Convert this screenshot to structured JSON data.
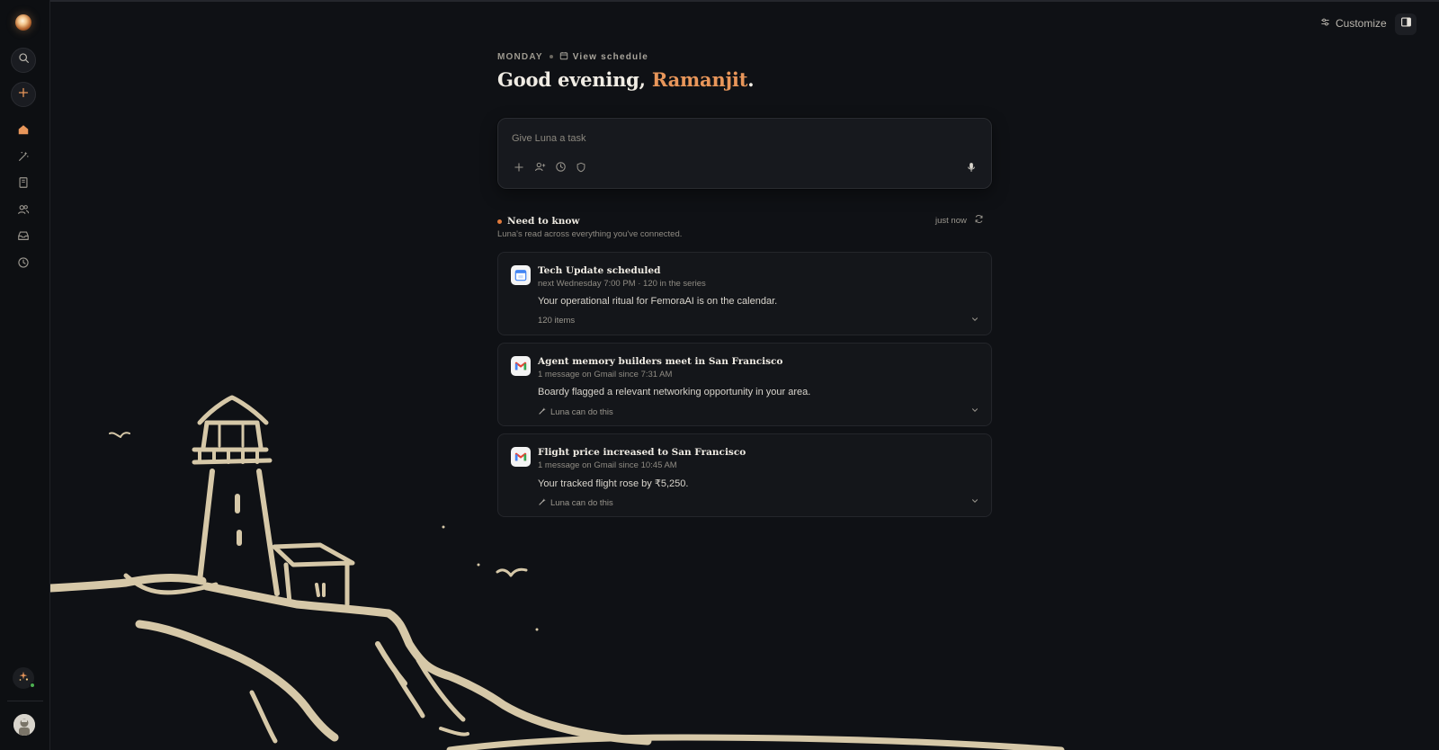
{
  "header": {
    "day": "MONDAY",
    "view_schedule": "View schedule",
    "greeting_prefix": "Good evening, ",
    "greeting_name": "Ramanjit",
    "greeting_suffix": "."
  },
  "topbar": {
    "customize": "Customize"
  },
  "composer": {
    "placeholder": "Give Luna a task"
  },
  "need_to_know": {
    "title": "Need to know",
    "subtitle": "Luna's read across everything you've connected.",
    "updated": "just now"
  },
  "cards": [
    {
      "icon": "google-calendar-icon",
      "title": "Tech Update scheduled",
      "meta": "next Wednesday 7:00 PM · 120 in the series",
      "body": "Your operational ritual for FemoraAI is on the calendar.",
      "footer": "120 items"
    },
    {
      "icon": "gmail-icon",
      "title": "Agent memory builders meet in San Francisco",
      "meta": "1 message on Gmail since 7:31 AM",
      "body": "Boardy flagged a relevant networking opportunity in your area.",
      "footer": "Luna can do this"
    },
    {
      "icon": "gmail-icon",
      "title": "Flight price increased to San Francisco",
      "meta": "1 message on Gmail since 10:45 AM",
      "body": "Your tracked flight rose by ₹5,250.",
      "footer": "Luna can do this"
    }
  ],
  "sidebar": {
    "items": [
      "search-icon",
      "new-task-icon",
      "home-icon",
      "skills-icon",
      "library-icon",
      "people-icon",
      "inbox-icon",
      "history-icon"
    ]
  },
  "colors": {
    "background": "#0f1115",
    "accent": "#e8965a",
    "illustration": "#d6c8a8"
  }
}
